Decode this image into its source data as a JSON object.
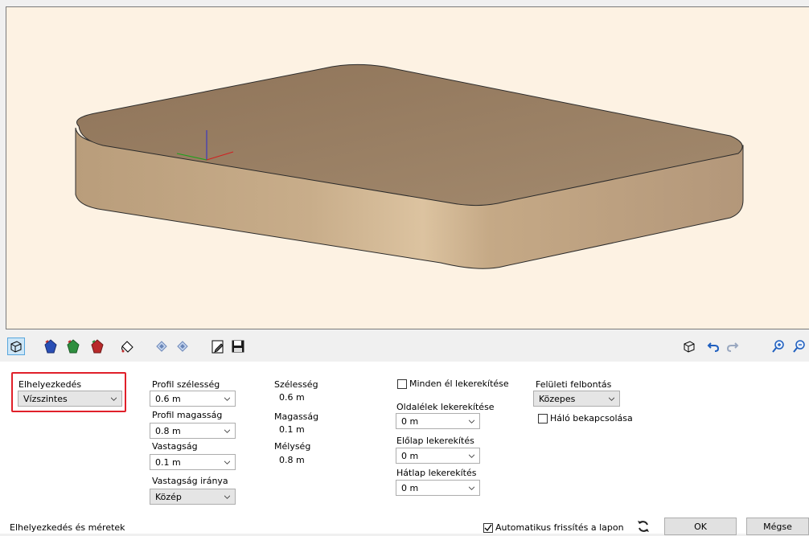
{
  "toolbar": {
    "left_icons": [
      "view-3d-icon",
      "turn-blue-icon",
      "turn-green-icon",
      "turn-red-icon",
      "paint-icon",
      "mirror-left-icon",
      "mirror-right-icon",
      "edit-doc-icon",
      "save-icon"
    ],
    "right_icons": [
      "box-view-icon",
      "undo-icon",
      "redo-icon",
      "zoom-in-icon",
      "zoom-out-icon"
    ]
  },
  "placement": {
    "label": "Elhelyezkedés",
    "value": "Vízszintes"
  },
  "profile": {
    "width_label": "Profil szélesség",
    "width_value": "0.6 m",
    "height_label": "Profil magasság",
    "height_value": "0.8 m",
    "thickness_label": "Vastagság",
    "thickness_value": "0.1 m",
    "direction_label": "Vastagság iránya",
    "direction_value": "Közép"
  },
  "dimensions": {
    "width_label": "Szélesség",
    "width_value": "0.6 m",
    "height_label": "Magasság",
    "height_value": "0.1 m",
    "depth_label": "Mélység",
    "depth_value": "0.8 m"
  },
  "rounding": {
    "all_edges_label": "Minden él lekerekítése",
    "side_label": "Oldalélek lekerekítése",
    "side_value": "0 m",
    "front_label": "Előlap lekerekítés",
    "front_value": "0 m",
    "back_label": "Hátlap lekerekítés",
    "back_value": "0 m"
  },
  "surface": {
    "label": "Felületi felbontás",
    "value": "Közepes",
    "mesh_label": "Háló bekapcsolása"
  },
  "footer": {
    "status": "Elhelyezkedés és méretek",
    "auto_refresh_label": "Automatikus frissítés a lapon",
    "ok_label": "OK",
    "cancel_label": "Mégse"
  },
  "colors": {
    "viewport_bg": "#fdf2e3",
    "slab_top": "#9a8065",
    "slab_side": "#c9ad88",
    "highlight": "#e0202a"
  }
}
